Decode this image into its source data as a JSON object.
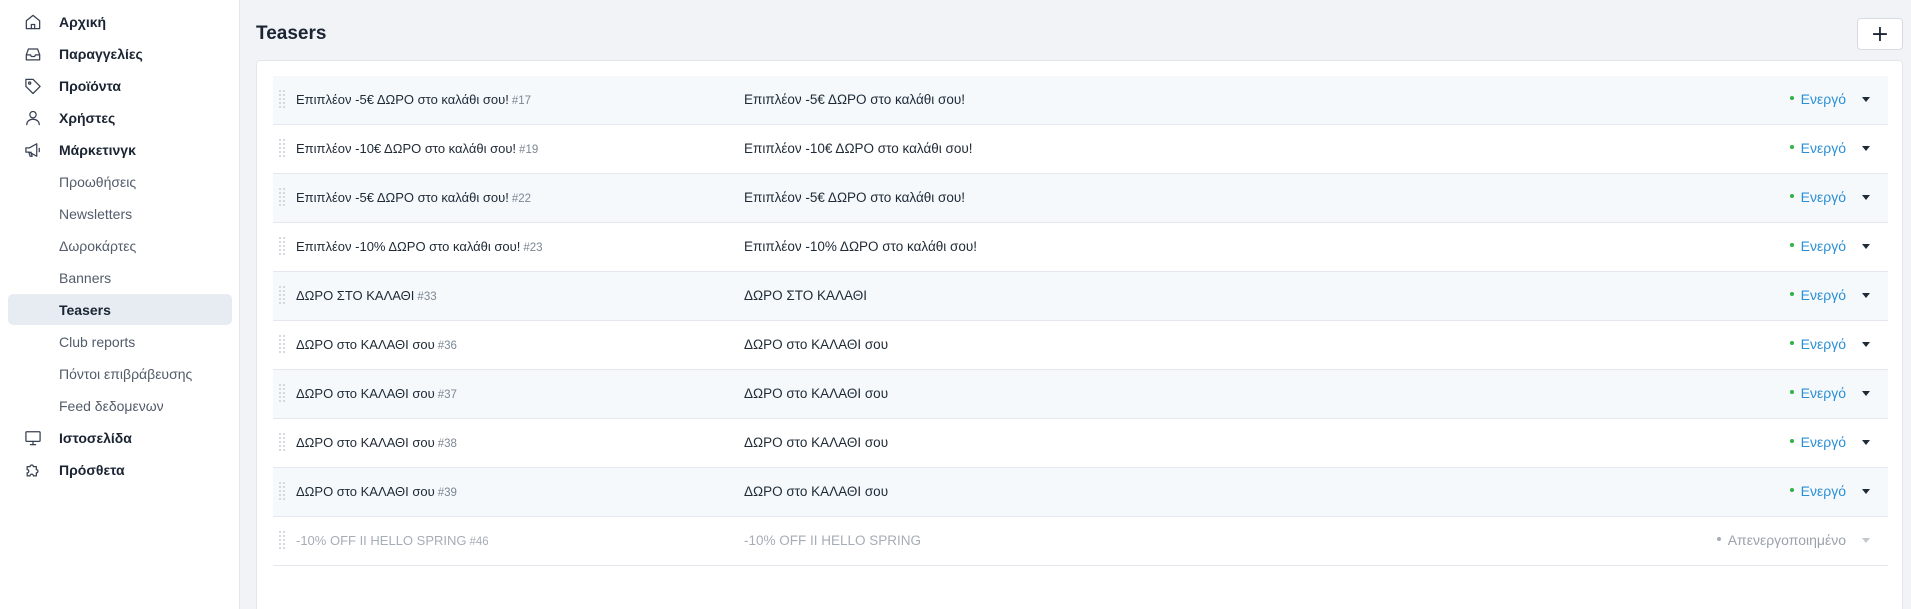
{
  "sidebar": {
    "top_items": [
      {
        "label": "Αρχική",
        "icon": "home-icon"
      },
      {
        "label": "Παραγγελίες",
        "icon": "inbox-icon"
      },
      {
        "label": "Προϊόντα",
        "icon": "tag-icon"
      },
      {
        "label": "Χρήστες",
        "icon": "user-icon"
      },
      {
        "label": "Μάρκετινγκ",
        "icon": "megaphone-icon"
      },
      {
        "label": "Ιστοσελίδα",
        "icon": "monitor-icon"
      },
      {
        "label": "Πρόσθετα",
        "icon": "puzzle-icon"
      }
    ],
    "marketing_items": [
      {
        "label": "Προωθήσεις"
      },
      {
        "label": "Newsletters"
      },
      {
        "label": "Δωροκάρτες"
      },
      {
        "label": "Banners"
      },
      {
        "label": "Teasers",
        "active": true
      },
      {
        "label": "Club reports"
      },
      {
        "label": "Πόντοι επιβράβευσης"
      },
      {
        "label": "Feed δεδομενων"
      }
    ]
  },
  "header": {
    "title": "Teasers",
    "add_label": "+"
  },
  "status_colors": {
    "active_dot": "#2fb344",
    "active_text": "#2a8fd6",
    "inactive": "#a6adb7"
  },
  "teasers": [
    {
      "title": "Επιπλέον -5€ ΔΩΡΟ στο καλάθι σου!",
      "id": "#17",
      "description": "Επιπλέον -5€ ΔΩΡΟ στο καλάθι σου!",
      "status": "Ενεργό",
      "active": true
    },
    {
      "title": "Επιπλέον -10€ ΔΩΡΟ στο καλάθι σου!",
      "id": "#19",
      "description": "Επιπλέον -10€ ΔΩΡΟ στο καλάθι σου!",
      "status": "Ενεργό",
      "active": true
    },
    {
      "title": "Επιπλέον -5€ ΔΩΡΟ στο καλάθι σου!",
      "id": "#22",
      "description": "Επιπλέον -5€ ΔΩΡΟ στο καλάθι σου!",
      "status": "Ενεργό",
      "active": true
    },
    {
      "title": "Επιπλέον -10% ΔΩΡΟ στο καλάθι σου!",
      "id": "#23",
      "description": "Επιπλέον -10% ΔΩΡΟ στο καλάθι σου!",
      "status": "Ενεργό",
      "active": true
    },
    {
      "title": "ΔΩΡΟ ΣΤΟ ΚΑΛΑΘΙ",
      "id": "#33",
      "description": "ΔΩΡΟ ΣΤΟ ΚΑΛΑΘΙ",
      "status": "Ενεργό",
      "active": true
    },
    {
      "title": "ΔΩΡΟ στο ΚΑΛΑΘΙ σου",
      "id": "#36",
      "description": "ΔΩΡΟ στο ΚΑΛΑΘΙ σου",
      "status": "Ενεργό",
      "active": true
    },
    {
      "title": "ΔΩΡΟ στο ΚΑΛΑΘΙ σου",
      "id": "#37",
      "description": "ΔΩΡΟ στο ΚΑΛΑΘΙ σου",
      "status": "Ενεργό",
      "active": true
    },
    {
      "title": "ΔΩΡΟ στο ΚΑΛΑΘΙ σου",
      "id": "#38",
      "description": "ΔΩΡΟ στο ΚΑΛΑΘΙ σου",
      "status": "Ενεργό",
      "active": true
    },
    {
      "title": "ΔΩΡΟ στο ΚΑΛΑΘΙ σου",
      "id": "#39",
      "description": "ΔΩΡΟ στο ΚΑΛΑΘΙ σου",
      "status": "Ενεργό",
      "active": true
    },
    {
      "title": "-10% OFF II HELLO SPRING",
      "id": "#46",
      "description": "-10% OFF II HELLO SPRING",
      "status": "Απενεργοποιημένο",
      "active": false
    }
  ]
}
